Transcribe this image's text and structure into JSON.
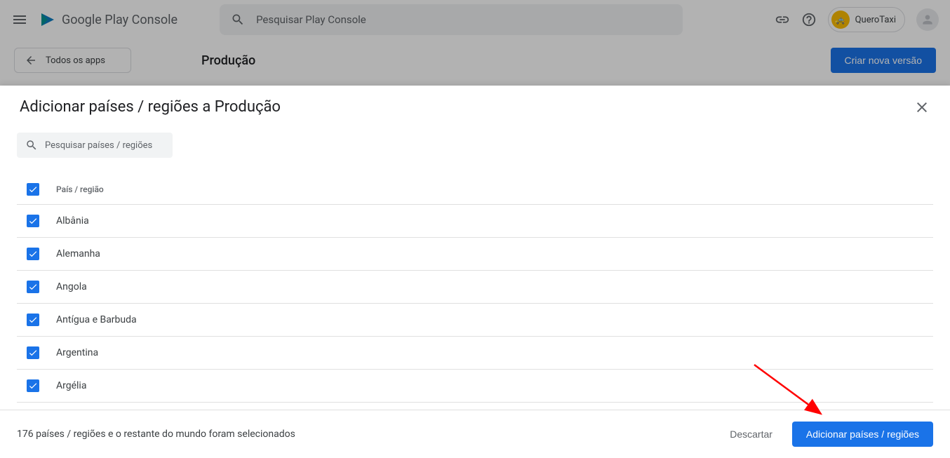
{
  "header": {
    "logo_text": "Google Play Console",
    "search_placeholder": "Pesquisar Play Console",
    "app_name": "QueroTaxi"
  },
  "subheader": {
    "back_label": "Todos os apps",
    "page_title": "Produção",
    "create_version_label": "Criar nova versão"
  },
  "dialog": {
    "title": "Adicionar países / regiões a Produção",
    "search_placeholder": "Pesquisar países / regiões",
    "column_header": "País / região",
    "countries": [
      {
        "name": "Albânia",
        "checked": true
      },
      {
        "name": "Alemanha",
        "checked": true
      },
      {
        "name": "Angola",
        "checked": true
      },
      {
        "name": "Antígua e Barbuda",
        "checked": true
      },
      {
        "name": "Argentina",
        "checked": true
      },
      {
        "name": "Argélia",
        "checked": true
      }
    ],
    "selection_text": "176 países / regiões e o restante do mundo foram selecionados",
    "discard_label": "Descartar",
    "add_label": "Adicionar países / regiões"
  }
}
